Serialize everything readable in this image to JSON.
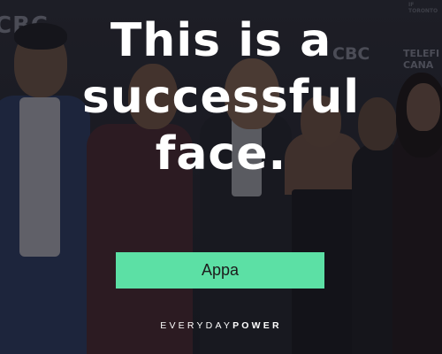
{
  "background": {
    "logos": {
      "left": "CBC",
      "right": "CBC",
      "telefilm_line1": "TELEFI",
      "telefilm_line2": "CANA",
      "top_right": "IF TORONTO"
    }
  },
  "quote": {
    "line1": "This is a",
    "line2": "successful",
    "line3": "face."
  },
  "author": {
    "name": "Appa"
  },
  "brand": {
    "part1": "EVERYDAY",
    "part2": "POWER"
  },
  "colors": {
    "badge": "#5ce0a5",
    "quote_text": "#ffffff",
    "backdrop": "#1d1e26"
  }
}
